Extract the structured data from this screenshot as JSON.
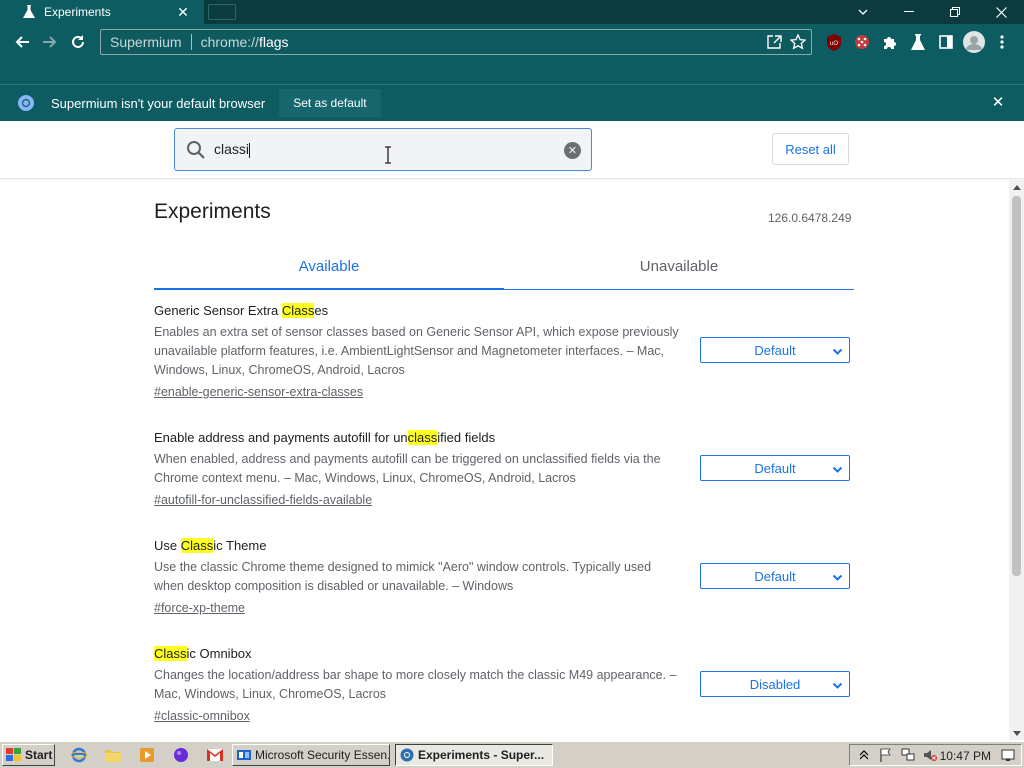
{
  "browser": {
    "tab_title": "Experiments",
    "omnibox_brand": "Supermium",
    "omnibox_scheme": "chrome://",
    "omnibox_path": "flags"
  },
  "infobar": {
    "message": "Supermium isn't your default browser",
    "button": "Set as default"
  },
  "search": {
    "value": "classi",
    "reset_label": "Reset all"
  },
  "page": {
    "title": "Experiments",
    "version": "126.0.6478.249",
    "tabs": {
      "available": "Available",
      "unavailable": "Unavailable"
    }
  },
  "flags": [
    {
      "name_pre": "Generic Sensor Extra ",
      "name_mark": "Class",
      "name_post": "es",
      "description": "Enables an extra set of sensor classes based on Generic Sensor API, which expose previously unavailable platform features, i.e. AmbientLightSensor and Magnetometer interfaces. – Mac, Windows, Linux, ChromeOS, Android, Lacros",
      "link": "#enable-generic-sensor-extra-classes",
      "value": "Default"
    },
    {
      "name_pre": "Enable address and payments autofill for un",
      "name_mark": "class",
      "name_post": "ified fields",
      "description": "When enabled, address and payments autofill can be triggered on unclassified fields via the Chrome context menu. – Mac, Windows, Linux, ChromeOS, Android, Lacros",
      "link": "#autofill-for-unclassified-fields-available",
      "value": "Default"
    },
    {
      "name_pre": "Use ",
      "name_mark": "Class",
      "name_post": "ic Theme",
      "description": "Use the classic Chrome theme designed to mimick \"Aero\" window controls. Typically used when desktop composition is disabled or unavailable. – Windows",
      "link": "#force-xp-theme",
      "value": "Default"
    },
    {
      "name_pre": "",
      "name_mark": "Class",
      "name_post": "ic Omnibox",
      "description": "Changes the location/address bar shape to more closely match the classic M49 appearance. – Mac, Windows, Linux, ChromeOS, Lacros",
      "link": "#classic-omnibox",
      "value": "Disabled"
    }
  ],
  "taskbar": {
    "start": "Start",
    "tasks": [
      {
        "label": "Microsoft Security Essen...",
        "icon": "security-essentials-icon"
      },
      {
        "label": "Experiments - Super...",
        "icon": "supermium-icon"
      }
    ],
    "clock": "10:47 PM"
  },
  "colors": {
    "titlebar": "#0b3a3f",
    "toolbar": "#0d5c62",
    "accent": "#1a73e8",
    "highlight": "#ffff1e",
    "taskbar": "#d4d0c8"
  }
}
